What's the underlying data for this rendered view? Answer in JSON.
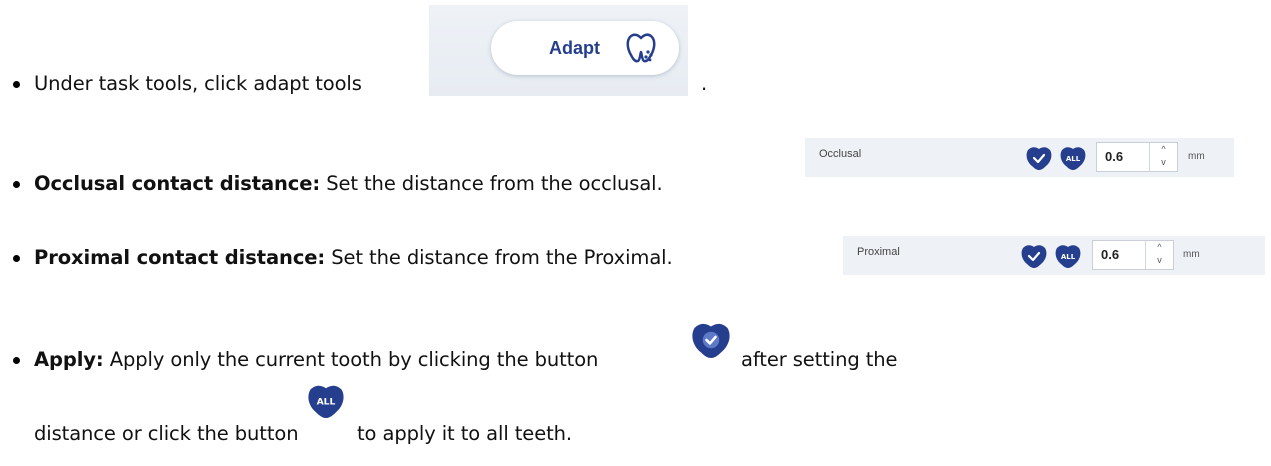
{
  "items": [
    {
      "text_before": "Under task tools, click adapt tools",
      "text_after": "."
    },
    {
      "bold": "Occlusal contact distance:",
      "text": " Set the distance from the occlusal."
    },
    {
      "bold": "Proximal contact distance:",
      "text": " Set the distance from the Proximal."
    },
    {
      "bold": "Apply:",
      "text_a": " Apply only the current tooth by clicking the button",
      "text_b": "after setting the"
    },
    {
      "text_a": "distance or click the button",
      "text_b": "to apply it to all teeth."
    }
  ],
  "adapt_button": {
    "label": "Adapt",
    "icon": "tooth-adapt-icon"
  },
  "occlusal_row": {
    "label": "Occlusal",
    "value": "0.6",
    "unit": "mm",
    "up": "^",
    "down": "v"
  },
  "proximal_row": {
    "label": "Proximal",
    "value": "0.6",
    "unit": "mm",
    "up": "^",
    "down": "v"
  },
  "all_badge": "ALL",
  "colors": {
    "brand": "#253e8e",
    "panel": "#eef1f5"
  }
}
